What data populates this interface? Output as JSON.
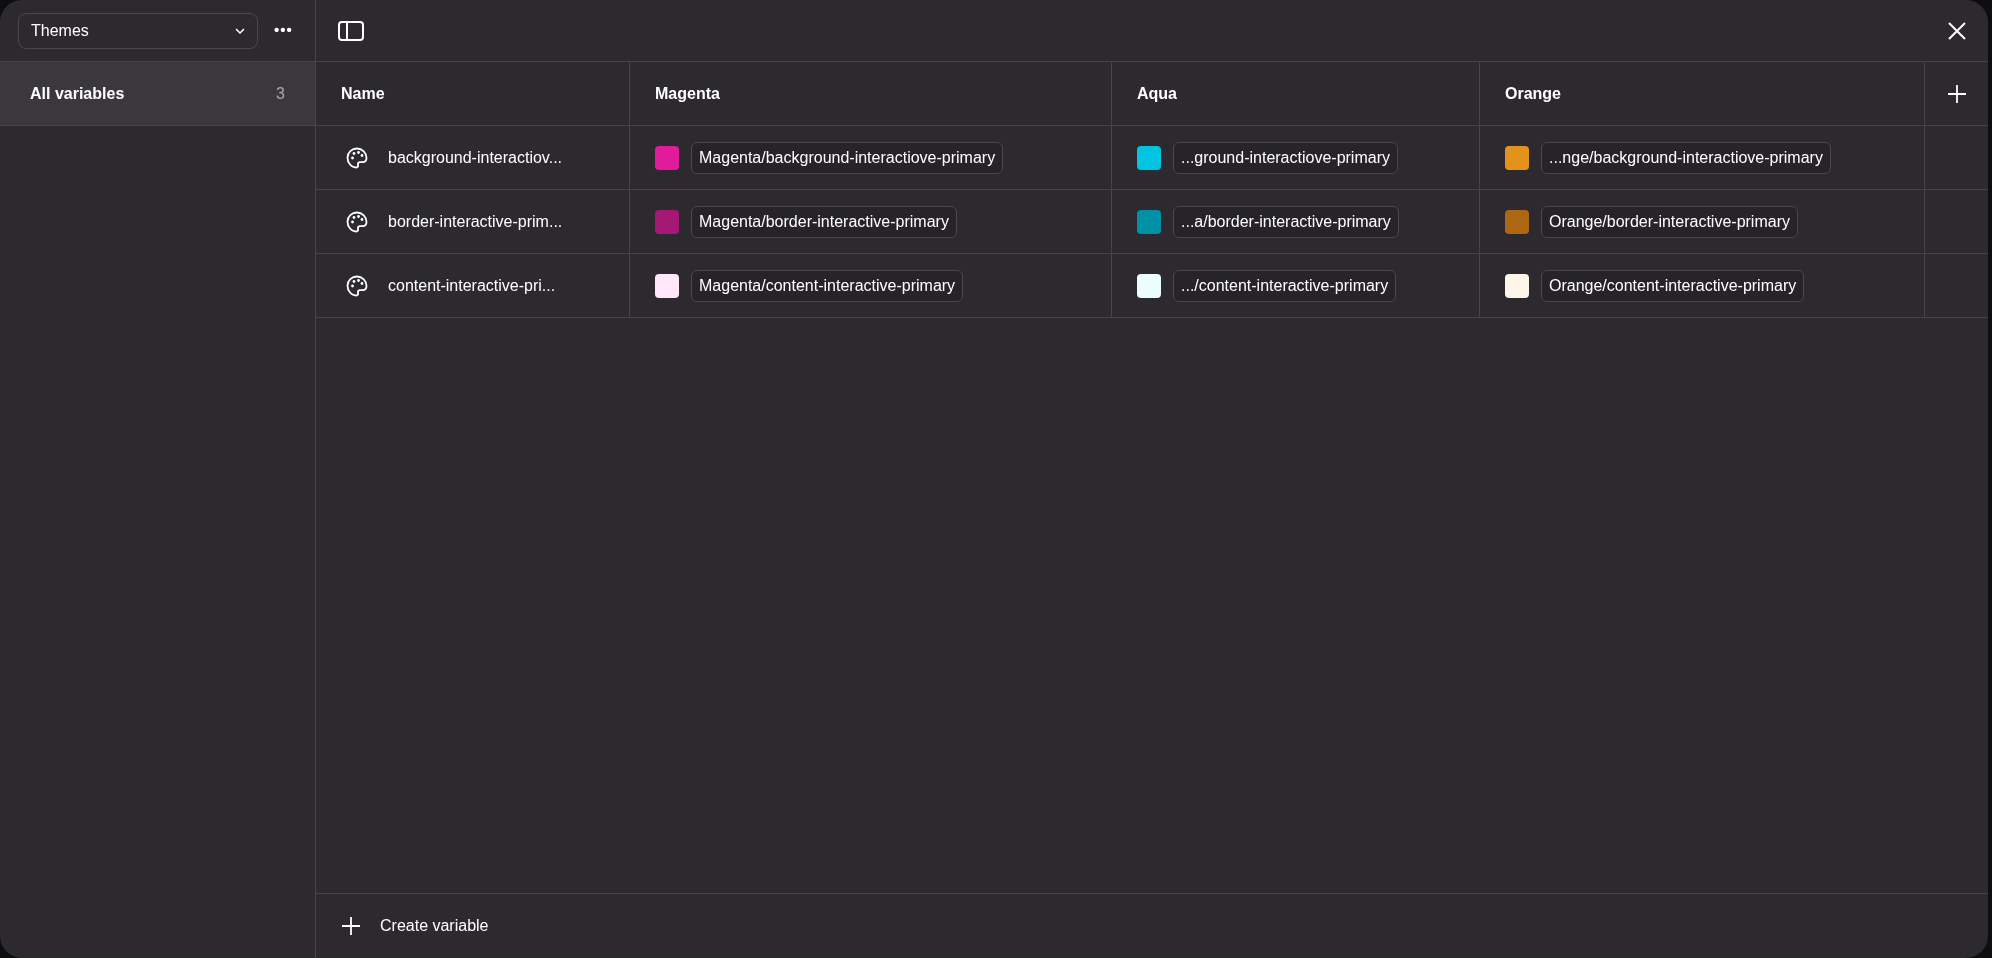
{
  "sidebar": {
    "theme_select": "Themes",
    "more_button": "•••",
    "items": [
      {
        "label": "All variables",
        "count": "3",
        "selected": true
      }
    ]
  },
  "table": {
    "columns": [
      "Name",
      "Magenta",
      "Aqua",
      "Orange"
    ],
    "rows": [
      {
        "name": "background-interactiov...",
        "values": [
          {
            "color": "#e01c9c",
            "text": "Magenta/background-interactiove-primary"
          },
          {
            "color": "#00c4e0",
            "text": "...ground-interactiove-primary"
          },
          {
            "color": "#e3921c",
            "text": "...nge/background-interactiove-primary"
          }
        ]
      },
      {
        "name": "border-interactive-prim...",
        "values": [
          {
            "color": "#a51875",
            "text": "Magenta/border-interactive-primary"
          },
          {
            "color": "#0091a6",
            "text": "...a/border-interactive-primary"
          },
          {
            "color": "#ad6714",
            "text": "Orange/border-interactive-primary"
          }
        ]
      },
      {
        "name": "content-interactive-pri...",
        "values": [
          {
            "color": "#ffe6f8",
            "text": "Magenta/content-interactive-primary"
          },
          {
            "color": "#ecfdfe",
            "text": ".../content-interactive-primary"
          },
          {
            "color": "#fff5e8",
            "text": "Orange/content-interactive-primary"
          }
        ]
      }
    ]
  },
  "footer": {
    "create_button": "Create variable"
  }
}
